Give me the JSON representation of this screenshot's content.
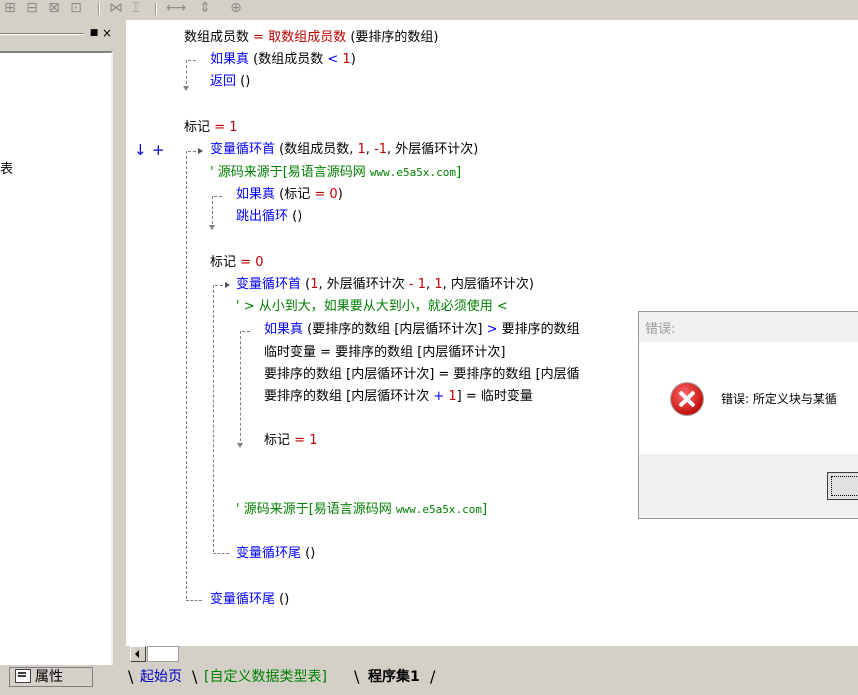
{
  "toolbar": {
    "buttons": [
      {
        "name": "tb-align-left-icon",
        "glyph": "⊞"
      },
      {
        "name": "tb-align-top-icon",
        "glyph": "⊟"
      },
      {
        "name": "tb-align-bottom-icon",
        "glyph": "⊠"
      },
      {
        "name": "tb-align-right-icon",
        "glyph": "⊡"
      },
      {
        "name": "tb-space-h-icon",
        "glyph": "⋈"
      },
      {
        "name": "tb-space-v-icon",
        "glyph": "⌶"
      },
      {
        "name": "tb-width-icon",
        "glyph": "⟷"
      },
      {
        "name": "tb-height-icon",
        "glyph": "⇕"
      },
      {
        "name": "tb-size-icon",
        "glyph": "⊕"
      }
    ]
  },
  "left_panel": {
    "partial_text": "表",
    "pin_label": "■",
    "close_label": "×",
    "properties_tab": "属性"
  },
  "code": {
    "l1": {
      "a": "数组成员数",
      "b": " = ",
      "c": "取数组成员数",
      "d": " (要排序的数组)"
    },
    "l2": {
      "a": "如果真",
      "b": " (数组成员数 ",
      "c": "<",
      "d": " ",
      "e": "1",
      ")": ")"
    },
    "l3": {
      "a": "返回",
      "b": " ()"
    },
    "l4": {
      "a": "标记",
      "b": " = ",
      "c": "1"
    },
    "l5": {
      "a": "变量循环首",
      "b": " (数组成员数, ",
      "c": "1",
      ",": ", ",
      "d": "-1",
      ",2": ", 外层循环计次)"
    },
    "l6": {
      "a": "' 源码来源于[易语言源码网 ",
      "b": "www.e5a5x.com",
      "c": "]"
    },
    "l7": {
      "a": "如果真",
      "b": " (标记 ",
      "c": "=",
      "d": " ",
      "e": "0",
      ")": ")"
    },
    "l8": {
      "a": "跳出循环",
      "b": " ()"
    },
    "l9": {
      "a": "标记",
      "b": " = ",
      "c": "0"
    },
    "l10": {
      "a": "变量循环首",
      "b": " (",
      "c": "1",
      ",": ", 外层循环计次 ",
      "d": "-",
      "e": " ",
      "f": "1",
      ",2": ", ",
      "g": "1",
      ",3": ", 内层循环计次)"
    },
    "l11": {
      "a": "' > 从小到大，如果要从大到小，就必须使用 <"
    },
    "l12": {
      "a": "如果真",
      "b": " (要排序的数组 [内层循环计次] ",
      "c": ">",
      "d": " 要排序的数组"
    },
    "l13": {
      "a": "临时变量 = 要排序的数组 [内层循环计次]"
    },
    "l14": {
      "a": "要排序的数组 [内层循环计次] = 要排序的数组 [内层循"
    },
    "l15": {
      "a": "要排序的数组 [内层循环计次 ",
      "b": "+",
      "c": " ",
      "d": "1",
      "e": "] = 临时变量"
    },
    "l16": {
      "a": "标记",
      "b": " = ",
      "c": "1"
    },
    "l17": {
      "a": "' 源码来源于[易语言源码网 ",
      "b": "www.e5a5x.com",
      "c": "]"
    },
    "l18": {
      "a": "变量循环尾",
      "b": " ()"
    },
    "l19": {
      "a": "变量循环尾",
      "b": " ()"
    }
  },
  "markers": {
    "arrow": "↓",
    "plus": "+"
  },
  "tabs": [
    {
      "label": "起始页",
      "color": "#0000c0",
      "bold": false
    },
    {
      "label": "[自定义数据类型表]",
      "color": "#008000",
      "bold": false
    },
    {
      "label": "程序集1",
      "color": "#000000",
      "bold": true
    }
  ],
  "tab_slash": "\\",
  "dialog": {
    "title": "错误:",
    "message": "错误: 所定义块与某循",
    "icon": "error-icon"
  },
  "colors": {
    "keyword": "#0000ff",
    "builtin": "#c00000",
    "comment": "#008000",
    "number": "#c00000"
  }
}
